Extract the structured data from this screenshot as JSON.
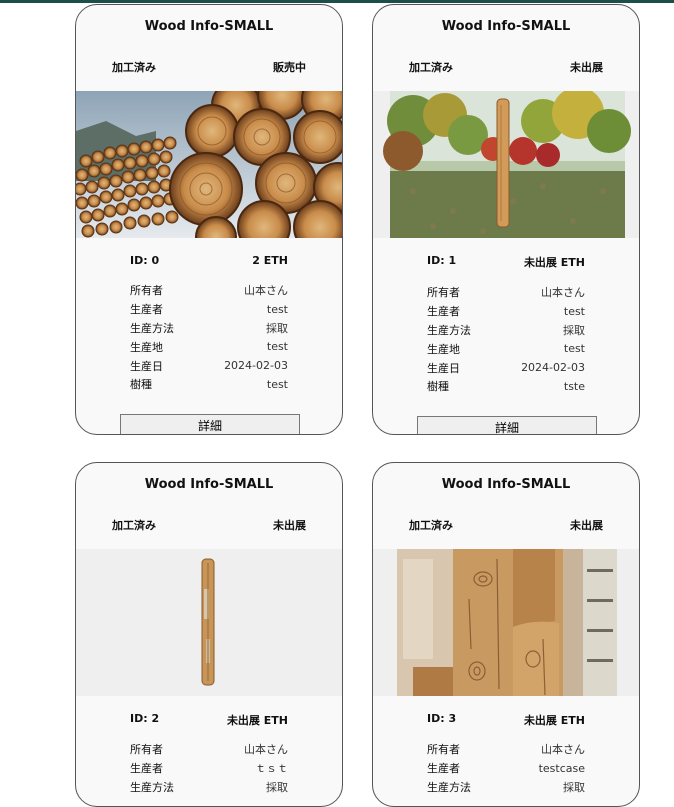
{
  "cards": [
    {
      "title": "Wood Info-SMALL",
      "status_left": "加工済み",
      "status_right": "販売中",
      "image": "log-pile-photo",
      "id_label": "ID: 0",
      "price": "2 ETH",
      "details": [
        {
          "key": "所有者",
          "value": "山本さん"
        },
        {
          "key": "生産者",
          "value": "test"
        },
        {
          "key": "生産方法",
          "value": "採取"
        },
        {
          "key": "生産地",
          "value": "test"
        },
        {
          "key": "生産日",
          "value": "2024-02-03"
        },
        {
          "key": "樹種",
          "value": "test"
        }
      ],
      "button": "詳細"
    },
    {
      "title": "Wood Info-SMALL",
      "status_left": "加工済み",
      "status_right": "未出展",
      "image": "log-in-park-photo",
      "id_label": "ID: 1",
      "price": "未出展 ETH",
      "details": [
        {
          "key": "所有者",
          "value": "山本さん"
        },
        {
          "key": "生産者",
          "value": "test"
        },
        {
          "key": "生産方法",
          "value": "採取"
        },
        {
          "key": "生産地",
          "value": "test"
        },
        {
          "key": "生産日",
          "value": "2024-02-03"
        },
        {
          "key": "樹種",
          "value": "tste"
        }
      ],
      "button": "詳細"
    },
    {
      "title": "Wood Info-SMALL",
      "status_left": "加工済み",
      "status_right": "未出展",
      "image": "single-log-photo",
      "id_label": "ID: 2",
      "price": "未出展 ETH",
      "details": [
        {
          "key": "所有者",
          "value": "山本さん"
        },
        {
          "key": "生産者",
          "value": "ｔｓｔ"
        },
        {
          "key": "生産方法",
          "value": "採取"
        }
      ],
      "button": ""
    },
    {
      "title": "Wood Info-SMALL",
      "status_left": "加工済み",
      "status_right": "未出展",
      "image": "log-closeup-photo",
      "id_label": "ID: 3",
      "price": "未出展 ETH",
      "details": [
        {
          "key": "所有者",
          "value": "山本さん"
        },
        {
          "key": "生産者",
          "value": "testcase"
        },
        {
          "key": "生産方法",
          "value": "採取"
        }
      ],
      "button": ""
    }
  ],
  "colors": {
    "card_bg": "#f9f9f9",
    "border": "#555555",
    "top_bar": "#1f4d4a",
    "button_bg": "#efefef"
  }
}
